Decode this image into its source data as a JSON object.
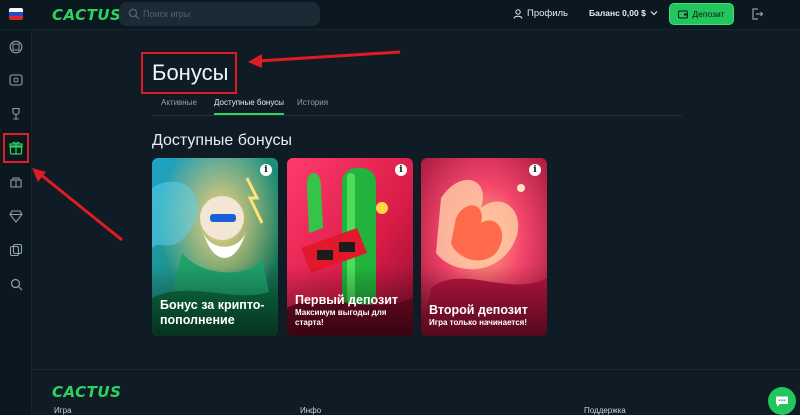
{
  "header": {
    "logo": "CACTUS",
    "search_placeholder": "Поиск игры",
    "profile_label": "Профиль",
    "balance_label": "Баланс 0,00 $",
    "deposit_label": "Депозит"
  },
  "sidebar": {
    "items": [
      "casino-icon",
      "live-icon",
      "trophy-icon",
      "bonus-gift-icon",
      "promo-icon",
      "vip-diamond-icon",
      "cards-icon",
      "search-icon"
    ],
    "active_item": "bonus-gift-icon"
  },
  "page": {
    "title": "Бонусы",
    "tabs": [
      {
        "label": "Активные",
        "active": false
      },
      {
        "label": "Доступные бонусы",
        "active": true
      },
      {
        "label": "История",
        "active": false
      }
    ],
    "section_title": "Доступные бонусы"
  },
  "cards": [
    {
      "title": "Бонус за крипто-пополнение",
      "subtitle": "",
      "info": "i"
    },
    {
      "title": "Первый депозит",
      "subtitle": "Максимум выгоды для старта!",
      "info": "i"
    },
    {
      "title": "Второй депозит",
      "subtitle": "Игра только начинается!",
      "info": "i"
    }
  ],
  "footer": {
    "logo": "CACTUS",
    "links": [
      "Игра",
      "Инфо",
      "Поддержка"
    ]
  },
  "colors": {
    "accent": "#2ed35f",
    "background": "#0f1c26",
    "annotation": "#e01b24"
  }
}
